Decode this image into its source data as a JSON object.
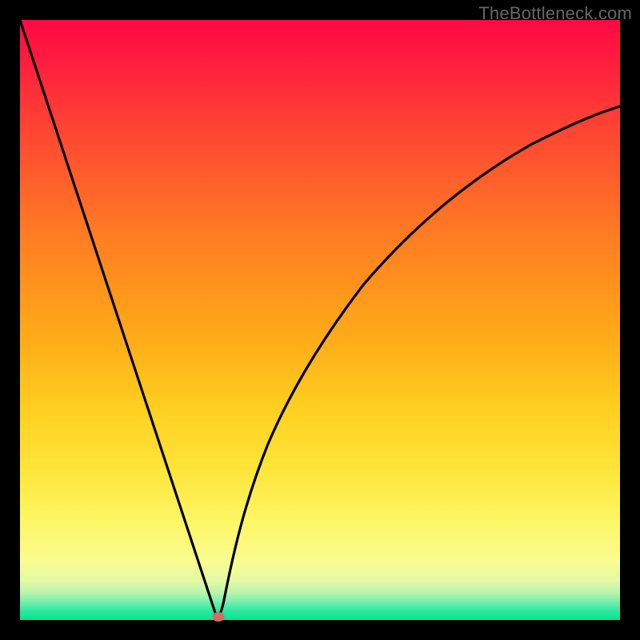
{
  "watermark": "TheBottleneck.com",
  "colors": {
    "frame": "#000000",
    "curve": "#000000",
    "dot": "#d66a66",
    "gradient_top": "#ff0a43",
    "gradient_bottom": "#00e68f"
  },
  "chart_data": {
    "type": "line",
    "title": "",
    "xlabel": "",
    "ylabel": "",
    "xlim": [
      0,
      100
    ],
    "ylim": [
      0,
      100
    ],
    "grid": false,
    "minimum_point": {
      "x": 33,
      "y": 0
    },
    "annotations": [
      {
        "kind": "dot",
        "x": 33,
        "y": 0.5,
        "color": "#d66a66"
      }
    ],
    "series": [
      {
        "name": "left-branch",
        "x": [
          0,
          4,
          8,
          12,
          16,
          20,
          24,
          28,
          30,
          31.5,
          32.5,
          33
        ],
        "y": [
          100,
          88,
          76,
          64,
          52,
          40,
          28,
          15,
          9,
          4,
          1.4,
          0
        ]
      },
      {
        "name": "right-branch",
        "x": [
          33,
          33.6,
          34.5,
          36,
          38,
          41,
          45,
          50,
          56,
          63,
          72,
          82,
          92,
          100
        ],
        "y": [
          0,
          1.4,
          4.5,
          10,
          18,
          27,
          36,
          45,
          53,
          60,
          67,
          73,
          78,
          81
        ]
      }
    ]
  }
}
